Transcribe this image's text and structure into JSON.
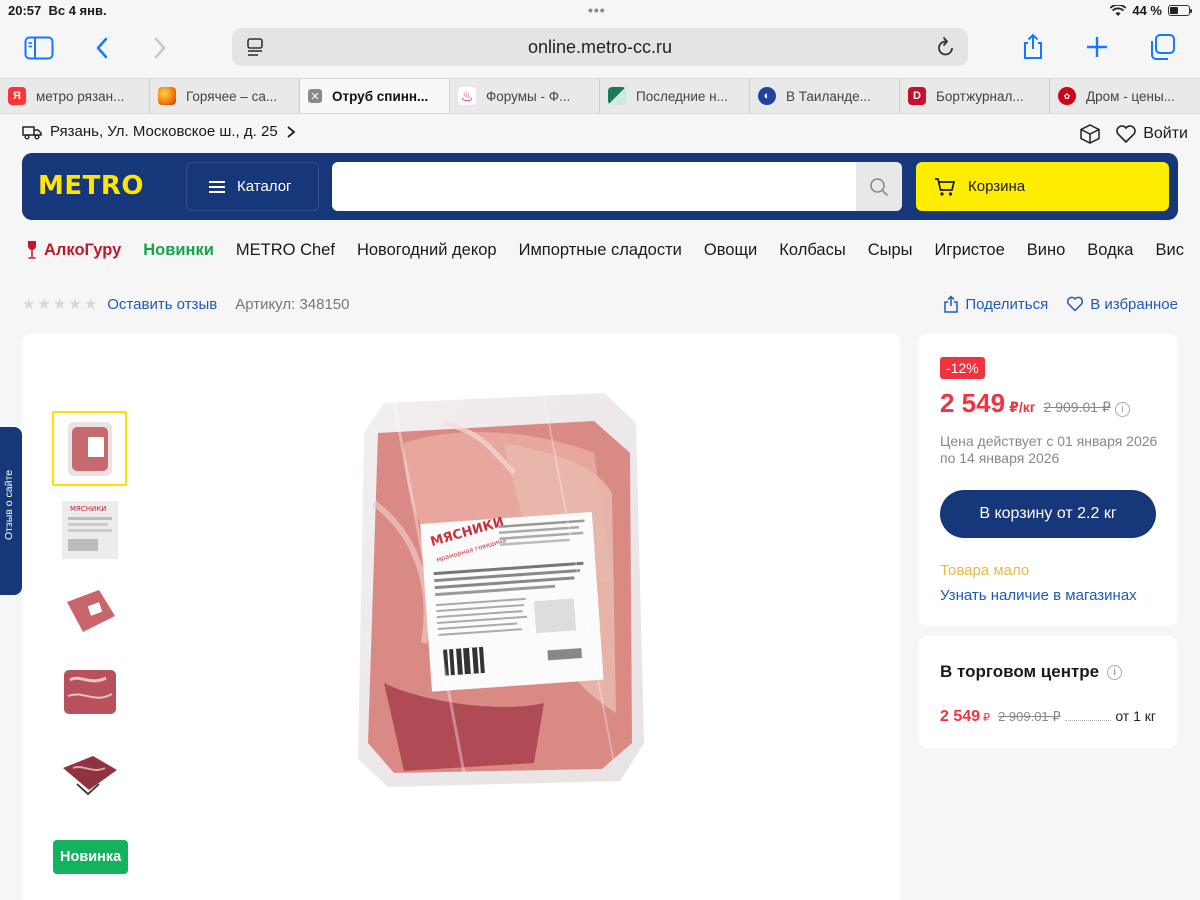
{
  "status_bar": {
    "time": "20:57",
    "date": "Вс 4 янв.",
    "battery": "44 %"
  },
  "browser": {
    "url": "online.metro-cc.ru",
    "tabs": [
      {
        "label": "метро рязан...",
        "icon": "yandex-icon",
        "color": "#f33"
      },
      {
        "label": "Горячее – са...",
        "icon": "pikabu-icon",
        "color": "#f59b00"
      },
      {
        "label": "Отруб спинн...",
        "icon": "close-icon",
        "color": "#777",
        "active": true
      },
      {
        "label": "Форумы - Ф...",
        "icon": "grill-icon",
        "color": "#c03"
      },
      {
        "label": "Последние н...",
        "icon": "news-icon",
        "color": "#2a8"
      },
      {
        "label": "В Таиланде...",
        "icon": "globe-icon",
        "color": "#2242a0"
      },
      {
        "label": "Бортжурнал...",
        "icon": "drive-icon",
        "color": "#c8102e"
      },
      {
        "label": "Дром - цены...",
        "icon": "drom-icon",
        "color": "#d0021b"
      }
    ]
  },
  "site": {
    "location": "Рязань, Ул. Московское ш., д. 25",
    "login": "Войти",
    "logo": "METRO",
    "catalog": "Каталог",
    "search_placeholder": "",
    "cart": "Корзина",
    "nav": [
      "АлкоГуру",
      "Новинки",
      "METRO Chef",
      "Новогодний декор",
      "Импортные сладости",
      "Овощи",
      "Колбасы",
      "Сыры",
      "Игристое",
      "Вино",
      "Водка",
      "Вис"
    ],
    "feedback_tab": "Отзыв о сайте"
  },
  "product": {
    "review_link": "Оставить отзыв",
    "sku": "Артикул: 348150",
    "share": "Поделиться",
    "favorite": "В избранное",
    "rating": 0,
    "badge_new": "Новинка",
    "discount": "-12%",
    "price": "2 549",
    "price_unit": "₽/кг",
    "old_price": "2 909.01 ₽",
    "validity": "Цена действует с 01 января 2026 по 14 января 2026",
    "cta": "В корзину от 2.2 кг",
    "stock": "Товара мало",
    "availability": "Узнать наличие в магазинах",
    "store_title": "В торговом центре",
    "store_price": "2 549",
    "store_currency": "₽",
    "store_old_price": "2 909.01 ₽",
    "store_min": "от 1 кг",
    "label_brand": "МЯСНИКИ",
    "label_sub": "мраморная говядина"
  },
  "colors": {
    "brand_blue": "#16387a",
    "brand_yellow": "#ffe600",
    "price_red": "#ef3340",
    "link": "#1f5ab8",
    "new_green": "#14b25f"
  }
}
